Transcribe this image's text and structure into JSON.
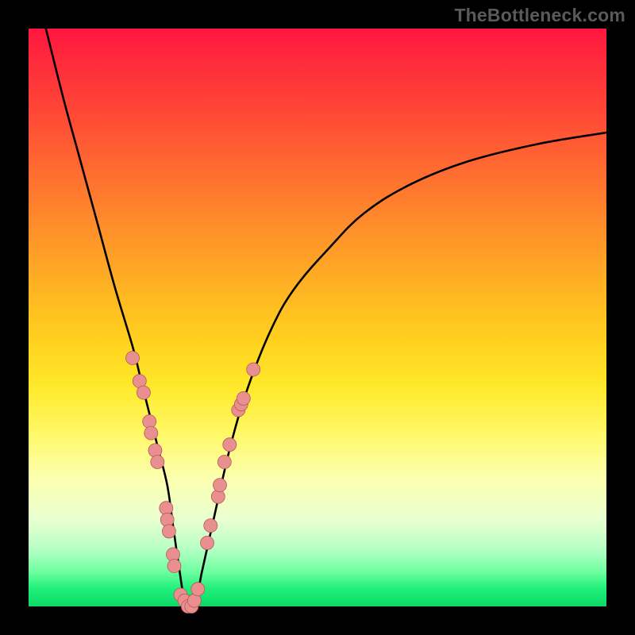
{
  "attribution": "TheBottleneck.com",
  "chart_data": {
    "type": "line",
    "title": "",
    "xlabel": "",
    "ylabel": "",
    "xlim": [
      0,
      100
    ],
    "ylim": [
      0,
      100
    ],
    "grid": false,
    "legend": false,
    "series": [
      {
        "name": "bottleneck-curve",
        "x": [
          3,
          6,
          9,
          12,
          15,
          18,
          19.5,
          21,
          22.5,
          24,
          25,
          26,
          27,
          28,
          29,
          30,
          32,
          35,
          38,
          42,
          46,
          52,
          58,
          66,
          76,
          88,
          100
        ],
        "y": [
          100,
          88,
          77,
          66,
          55,
          45,
          39,
          33,
          27,
          21,
          14,
          7,
          1,
          0,
          1,
          6,
          15,
          28,
          38,
          48,
          55,
          62,
          68,
          73,
          77,
          80,
          82
        ]
      }
    ],
    "marker_points": {
      "name": "highlight-dots",
      "points": [
        {
          "x": 18.0,
          "y": 43
        },
        {
          "x": 19.2,
          "y": 39
        },
        {
          "x": 19.9,
          "y": 37
        },
        {
          "x": 20.9,
          "y": 32
        },
        {
          "x": 21.2,
          "y": 30
        },
        {
          "x": 21.9,
          "y": 27
        },
        {
          "x": 22.3,
          "y": 25
        },
        {
          "x": 23.8,
          "y": 17
        },
        {
          "x": 24.0,
          "y": 15
        },
        {
          "x": 24.3,
          "y": 13
        },
        {
          "x": 25.0,
          "y": 9
        },
        {
          "x": 25.2,
          "y": 7
        },
        {
          "x": 26.3,
          "y": 2
        },
        {
          "x": 27.0,
          "y": 1
        },
        {
          "x": 27.6,
          "y": 0
        },
        {
          "x": 28.2,
          "y": 0
        },
        {
          "x": 28.7,
          "y": 1
        },
        {
          "x": 29.3,
          "y": 3
        },
        {
          "x": 30.9,
          "y": 11
        },
        {
          "x": 31.5,
          "y": 14
        },
        {
          "x": 32.8,
          "y": 19
        },
        {
          "x": 33.1,
          "y": 21
        },
        {
          "x": 33.9,
          "y": 25
        },
        {
          "x": 34.8,
          "y": 28
        },
        {
          "x": 36.3,
          "y": 34
        },
        {
          "x": 36.8,
          "y": 35
        },
        {
          "x": 37.2,
          "y": 36
        },
        {
          "x": 38.9,
          "y": 41
        }
      ]
    },
    "background_gradient_stops": [
      {
        "pos": 0.0,
        "color": "#ff163f"
      },
      {
        "pos": 0.35,
        "color": "#ff8d2b"
      },
      {
        "pos": 0.62,
        "color": "#ffe92a"
      },
      {
        "pos": 0.85,
        "color": "#e9ffd0"
      },
      {
        "pos": 1.0,
        "color": "#0cd966"
      }
    ]
  }
}
